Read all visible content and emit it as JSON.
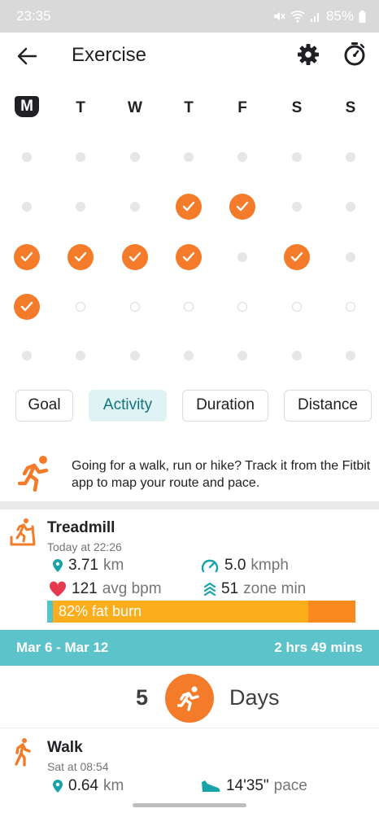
{
  "status_bar": {
    "time": "23:35",
    "battery": "85%"
  },
  "app_bar": {
    "title": "Exercise"
  },
  "week_days": [
    {
      "label": "M",
      "today": true
    },
    {
      "label": "T",
      "today": false
    },
    {
      "label": "W",
      "today": false
    },
    {
      "label": "T",
      "today": false
    },
    {
      "label": "F",
      "today": false
    },
    {
      "label": "S",
      "today": false
    },
    {
      "label": "S",
      "today": false
    }
  ],
  "history_grid": [
    [
      "dot",
      "dot",
      "dot",
      "dot",
      "dot",
      "dot",
      "dot"
    ],
    [
      "dot",
      "dot",
      "dot",
      "check",
      "check",
      "dot",
      "dot"
    ],
    [
      "check",
      "check",
      "check",
      "check",
      "dot",
      "check",
      "dot"
    ],
    [
      "check",
      "ring",
      "ring",
      "ring",
      "ring",
      "ring",
      "ring"
    ],
    [
      "dot",
      "dot",
      "dot",
      "dot",
      "dot",
      "dot",
      "dot"
    ]
  ],
  "filters": [
    {
      "label": "Goal",
      "active": false
    },
    {
      "label": "Activity",
      "active": true
    },
    {
      "label": "Duration",
      "active": false
    },
    {
      "label": "Distance",
      "active": false
    }
  ],
  "promo": {
    "text": "Going for a walk, run or hike? Track it from the Fitbit app to map your route and pace."
  },
  "treadmill": {
    "name": "Treadmill",
    "when": "Today at 22:26",
    "distance_value": "3.71",
    "distance_unit": "km",
    "speed_value": "5.0",
    "speed_unit": "kmph",
    "hr_value": "121",
    "hr_unit": "avg bpm",
    "zone_value": "51",
    "zone_unit": "zone min",
    "fat_burn_label": "82% fat burn"
  },
  "week_summary": {
    "range": "Mar 6 - Mar 12",
    "total": "2 hrs 49 mins",
    "days_count": "5",
    "days_label": "Days"
  },
  "walk": {
    "name": "Walk",
    "when": "Sat at 08:54",
    "distance_value": "0.64",
    "distance_unit": "km",
    "pace_value": "14'35\"",
    "pace_unit": "pace"
  },
  "colors": {
    "accent_orange": "#f47b2a",
    "teal": "#5cc3cb",
    "chip_active_bg": "#dff2f4",
    "fat_burn": "#fbad1c",
    "peak": "#f98a1f",
    "heart": "#e8384f"
  },
  "icons": [
    "back-arrow-icon",
    "gear-icon",
    "timer-icon",
    "check-icon",
    "runner-icon",
    "treadmill-icon",
    "location-pin-icon",
    "speedometer-icon",
    "heart-icon",
    "zone-icon",
    "walker-icon",
    "shoe-icon",
    "wifi-icon",
    "signal-icon",
    "mute-icon",
    "battery-icon"
  ]
}
